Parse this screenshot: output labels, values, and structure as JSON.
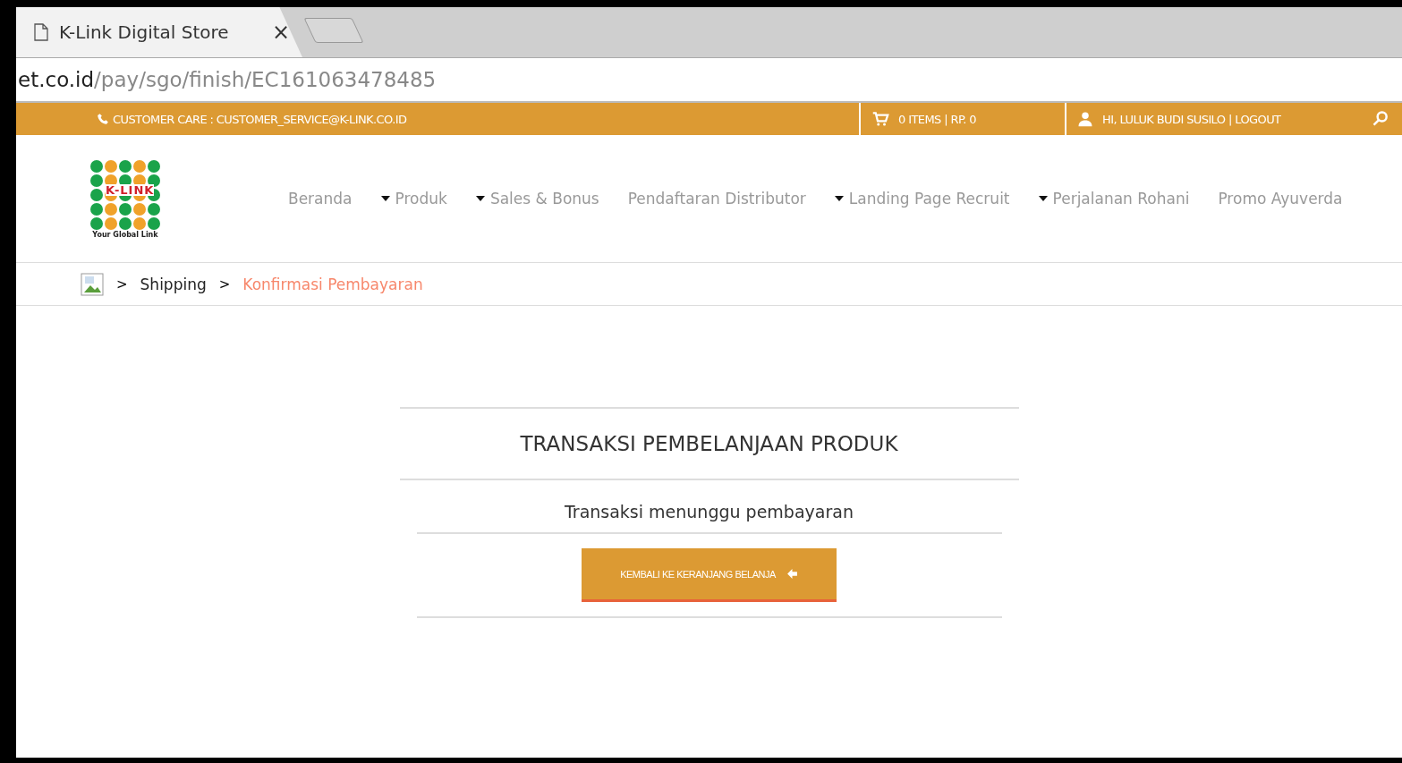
{
  "browser": {
    "tab_title": "K-Link Digital Store",
    "close": "×",
    "url_host": "et.co.id",
    "url_path": "/pay/sgo/finish/EC161063478485"
  },
  "topbar": {
    "customer_care": "CUSTOMER CARE : CUSTOMER_SERVICE@K-LINK.CO.ID",
    "cart": "0 ITEMS | RP. 0",
    "user": "HI, LULUK BUDI SUSILO | LOGOUT"
  },
  "logo": {
    "name": "K-LINK",
    "tagline": "Your Global Link"
  },
  "nav": [
    {
      "label": "Beranda",
      "dropdown": false
    },
    {
      "label": "Produk",
      "dropdown": true
    },
    {
      "label": "Sales & Bonus",
      "dropdown": true
    },
    {
      "label": "Pendaftaran Distributor",
      "dropdown": false
    },
    {
      "label": "Landing Page Recruit",
      "dropdown": true
    },
    {
      "label": "Perjalanan Rohani",
      "dropdown": true
    },
    {
      "label": "Promo Ayuverda",
      "dropdown": false
    }
  ],
  "breadcrumb": [
    {
      "label": "Shipping",
      "selected": false
    },
    {
      "label": "Konfirmasi Pembayaran",
      "selected": true
    }
  ],
  "breadcrumb_separator": ">",
  "panel": {
    "title": "TRANSAKSI PEMBELANJAAN PRODUK",
    "status": "Transaksi menunggu pembayaran",
    "button": "KEMBALI KE KERANJANG BELANJA"
  }
}
